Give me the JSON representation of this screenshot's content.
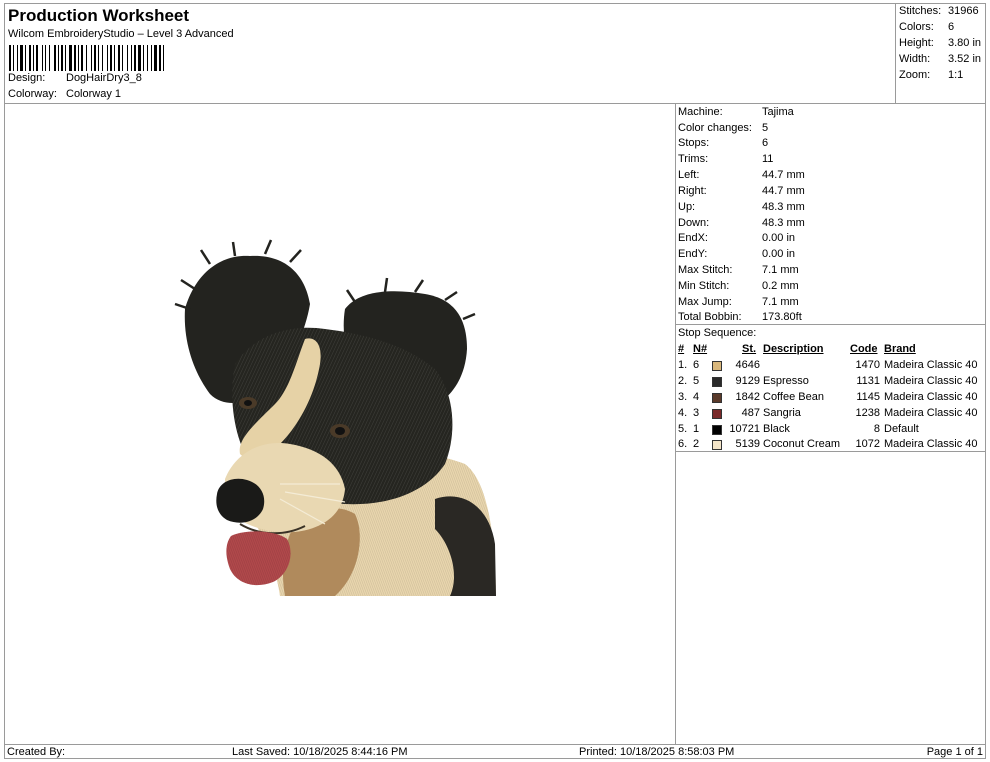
{
  "header": {
    "title": "Production Worksheet",
    "subtitle": "Wilcom EmbroideryStudio – Level 3 Advanced",
    "design_label": "Design:",
    "design_value": "DogHairDry3_8",
    "colorway_label": "Colorway:",
    "colorway_value": "Colorway 1"
  },
  "summary": [
    {
      "label": "Stitches:",
      "value": "31966"
    },
    {
      "label": "Colors:",
      "value": "6"
    },
    {
      "label": "Height:",
      "value": "3.80 in"
    },
    {
      "label": "Width:",
      "value": "3.52 in"
    },
    {
      "label": "Zoom:",
      "value": "1:1"
    }
  ],
  "machine_info": [
    {
      "label": "Machine:",
      "value": "Tajima"
    },
    {
      "label": "Color changes:",
      "value": "5"
    },
    {
      "label": "Stops:",
      "value": "6"
    },
    {
      "label": "Trims:",
      "value": "11"
    },
    {
      "label": "Left:",
      "value": "44.7 mm"
    },
    {
      "label": "Right:",
      "value": "44.7 mm"
    },
    {
      "label": "Up:",
      "value": "48.3 mm"
    },
    {
      "label": "Down:",
      "value": "48.3 mm"
    },
    {
      "label": "EndX:",
      "value": "0.00 in"
    },
    {
      "label": "EndY:",
      "value": "0.00 in"
    },
    {
      "label": "Max Stitch:",
      "value": "7.1 mm"
    },
    {
      "label": "Min Stitch:",
      "value": "0.2 mm"
    },
    {
      "label": "Max Jump:",
      "value": "7.1 mm"
    },
    {
      "label": "Total Bobbin:",
      "value": "173.80ft"
    }
  ],
  "stop_sequence": {
    "title": "Stop Sequence:",
    "headers": {
      "num": "#",
      "n": "N#",
      "st": "St.",
      "description": "Description",
      "code": "Code",
      "brand": "Brand"
    },
    "rows": [
      {
        "num": "1.",
        "n": "6",
        "color": "#d9b77c",
        "st": "4646",
        "description": "",
        "code": "1470",
        "brand": "Madeira Classic 40"
      },
      {
        "num": "2.",
        "n": "5",
        "color": "#2a2a2a",
        "st": "9129",
        "description": "Espresso",
        "code": "1131",
        "brand": "Madeira Classic 40"
      },
      {
        "num": "3.",
        "n": "4",
        "color": "#5a3a2a",
        "st": "1842",
        "description": "Coffee Bean",
        "code": "1145",
        "brand": "Madeira Classic 40"
      },
      {
        "num": "4.",
        "n": "3",
        "color": "#7a2a2a",
        "st": "487",
        "description": "Sangria",
        "code": "1238",
        "brand": "Madeira Classic 40"
      },
      {
        "num": "5.",
        "n": "1",
        "color": "#000000",
        "st": "10721",
        "description": "Black",
        "code": "8",
        "brand": "Default"
      },
      {
        "num": "6.",
        "n": "2",
        "color": "#f3e5c8",
        "st": "5139",
        "description": "Coconut Cream",
        "code": "1072",
        "brand": "Madeira Classic 40"
      }
    ]
  },
  "footer": {
    "created_by": "Created By:",
    "last_saved": "Last Saved: 10/18/2025 8:44:16 PM",
    "printed": "Printed: 10/18/2025 8:58:03 PM",
    "page": "Page 1 of 1"
  }
}
